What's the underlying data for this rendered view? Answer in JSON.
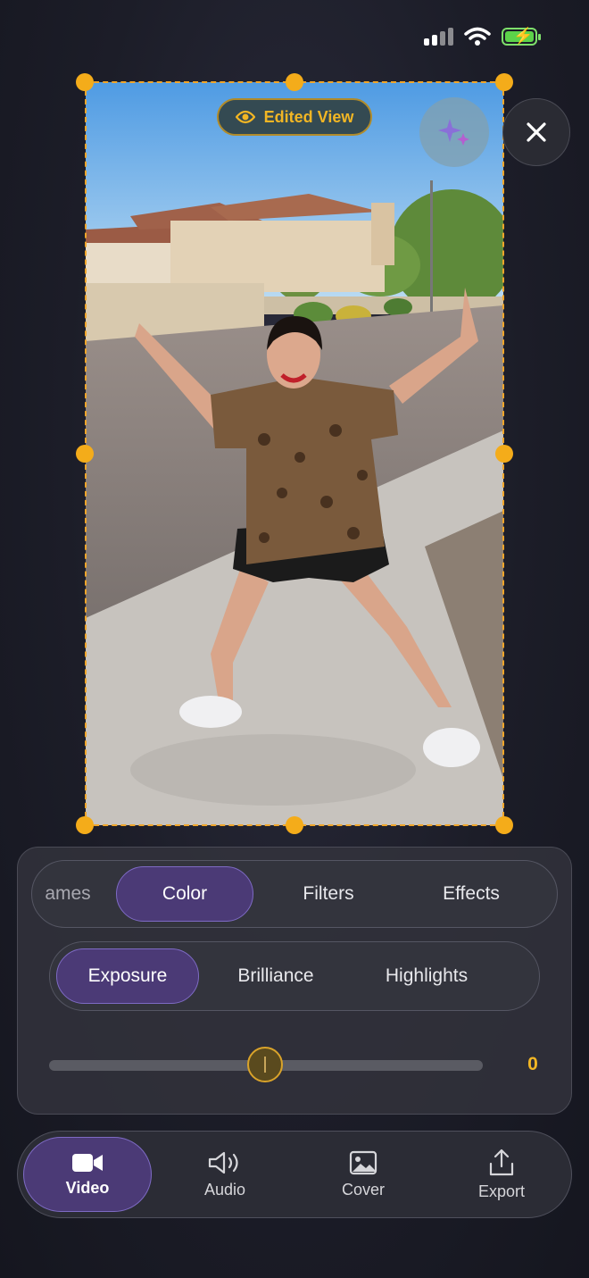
{
  "preview": {
    "edited_view_label": "Edited View"
  },
  "category_tabs": [
    {
      "label": "ames"
    },
    {
      "label": "Color"
    },
    {
      "label": "Filters"
    },
    {
      "label": "Effects"
    }
  ],
  "adjust_tabs": [
    {
      "label": "Exposure"
    },
    {
      "label": "Brilliance"
    },
    {
      "label": "Highlights"
    }
  ],
  "slider": {
    "value": "0",
    "level": 0.5
  },
  "toolbar": [
    {
      "label": "Video",
      "icon": "video-camera-icon"
    },
    {
      "label": "Audio",
      "icon": "speaker-icon"
    },
    {
      "label": "Cover",
      "icon": "image-icon"
    },
    {
      "label": "Export",
      "icon": "share-icon"
    }
  ],
  "colors": {
    "accent_purple": "#4b3a76",
    "accent_yellow": "#f2b624",
    "battery_green": "#5cd34a"
  }
}
